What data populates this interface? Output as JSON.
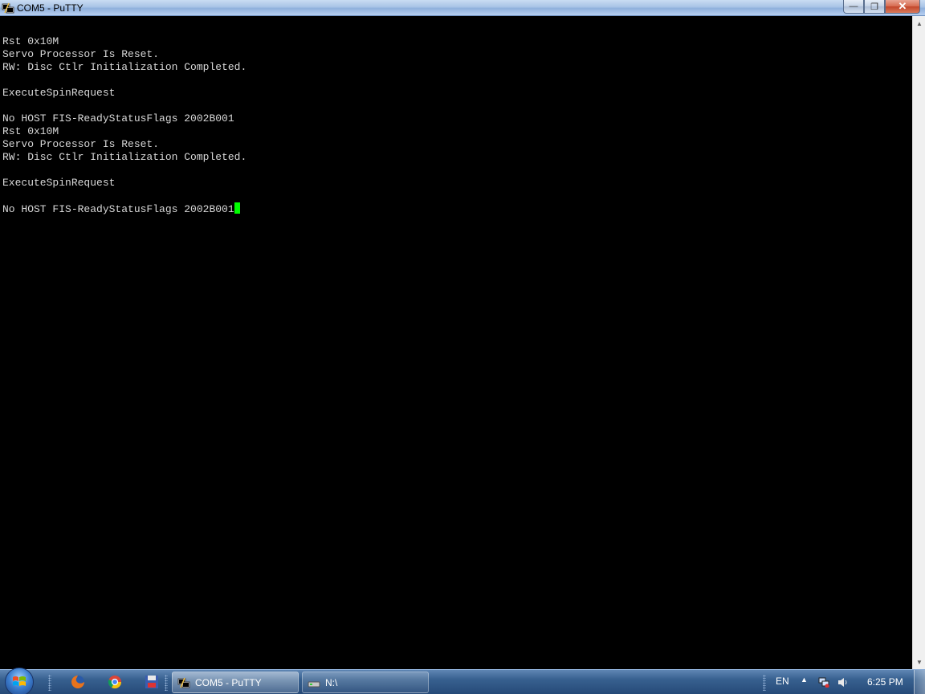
{
  "window": {
    "title": "COM5 - PuTTY",
    "buttons": {
      "minimize": "—",
      "maximize": "❐",
      "close": "✕"
    }
  },
  "terminal": {
    "lines": [
      "",
      "Rst 0x10M",
      "Servo Processor Is Reset.",
      "RW: Disc Ctlr Initialization Completed.",
      "",
      "ExecuteSpinRequest",
      "",
      "No HOST FIS-ReadyStatusFlags 2002B001",
      "Rst 0x10M",
      "Servo Processor Is Reset.",
      "RW: Disc Ctlr Initialization Completed.",
      "",
      "ExecuteSpinRequest",
      "",
      "No HOST FIS-ReadyStatusFlags 2002B001"
    ],
    "cursor_color": "#00ff00",
    "text_color": "#d8d8d8",
    "background": "#000000"
  },
  "taskbar": {
    "quick_launch": [
      "firefox-icon",
      "chrome-icon",
      "floppy-icon"
    ],
    "tasks": [
      {
        "label": "COM5 - PuTTY",
        "icon": "putty-icon",
        "active": true
      },
      {
        "label": "N:\\",
        "icon": "drive-icon",
        "active": false
      }
    ],
    "tray": {
      "language": "EN",
      "clock": "6:25 PM"
    }
  }
}
